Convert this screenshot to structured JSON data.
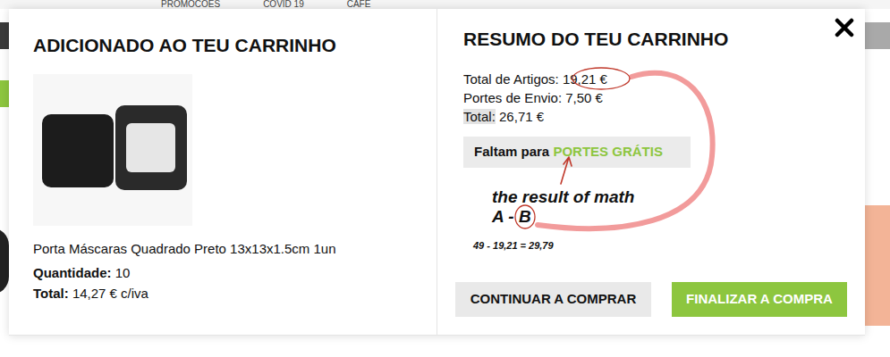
{
  "page": {
    "nav": [
      {
        "label": "PROMOCOES"
      },
      {
        "label": "COVID 19"
      },
      {
        "label": "CAFE"
      }
    ]
  },
  "added": {
    "title": "ADICIONADO AO TEU CARRINHO",
    "product_name": "Porta Máscaras Quadrado Preto 13x13x1.5cm 1un",
    "quantity_label": "Quantidade:",
    "quantity": "10",
    "total_label": "Total:",
    "total": "14,27 € c/iva"
  },
  "summary": {
    "title": "RESUMO DO TEU CARRINHO",
    "rows": [
      {
        "label": "Total de Artigos:",
        "value": "19,21 €",
        "highlighted": false
      },
      {
        "label": "Portes de Envio:",
        "value": "7,50 €",
        "highlighted": false
      },
      {
        "label": "Total:",
        "value": "26,71 €",
        "highlighted": true
      }
    ],
    "free_shipping": {
      "prefix": "Faltam para",
      "link": "PORTES GRÁTIS"
    }
  },
  "annotation": {
    "line": "the result of math",
    "expression": "A - ",
    "circled": "B",
    "formula": "49 - 19,21 = 29,79"
  },
  "buttons": [
    {
      "label": "CONTINUAR A COMPRAR",
      "kind": "secondary"
    },
    {
      "label": "FINALIZAR A COMPRA",
      "kind": "primary"
    }
  ]
}
